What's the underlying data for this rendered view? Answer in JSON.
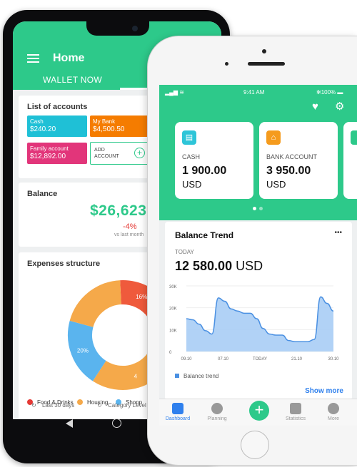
{
  "android": {
    "header": {
      "title": "Home",
      "tabs": [
        "WALLET NOW",
        "A"
      ]
    },
    "accounts": {
      "title": "List of accounts",
      "items": [
        {
          "name": "Cash",
          "amount": "$240.20",
          "color": "#1fc0d6"
        },
        {
          "name": "My Bank",
          "amount": "$4,500.50",
          "color": "#f57c00"
        },
        {
          "name": "Family account",
          "amount": "$12,892.00",
          "color": "#e2357a"
        }
      ],
      "add_label": [
        "ADD",
        "ACCOUNT"
      ]
    },
    "balance": {
      "title": "Balance",
      "amount": "$26,623.6",
      "change": "-4%",
      "vs": "vs last month"
    },
    "expenses": {
      "title": "Expenses structure",
      "chart_data": {
        "type": "pie",
        "title": "Expenses structure",
        "slices": [
          {
            "label": "16%",
            "value": 16,
            "color": "#ef5a3c"
          },
          {
            "label": "16%",
            "value": 16,
            "color": "#f06596"
          },
          {
            "label": "4",
            "value": 28,
            "color": "#f5a94a"
          },
          {
            "label": "20%",
            "value": 20,
            "color": "#5ab4ee"
          },
          {
            "label": "",
            "value": 20,
            "color": "#f5a94a"
          }
        ],
        "legend": [
          {
            "name": "Food & Drinks",
            "color": "#e53935"
          },
          {
            "name": "Housing",
            "color": "#f5a94a"
          },
          {
            "name": "Shopp",
            "color": "#5ab4ee"
          }
        ]
      }
    },
    "footer": {
      "period": "Last 30 days",
      "category": "Category Level 1"
    }
  },
  "iphone": {
    "status": {
      "time": "9:41 AM",
      "battery": "100%"
    },
    "cards": [
      {
        "label": "CASH",
        "value": "1 900.00",
        "currency": "USD",
        "icon_color": "#2ec5d8",
        "icon": "wallet-icon"
      },
      {
        "label": "BANK ACCOUNT",
        "value": "3 950.00",
        "currency": "USD",
        "icon_color": "#f59b1d",
        "icon": "bank-icon"
      }
    ],
    "trend": {
      "title": "Balance Trend",
      "menu": "•••",
      "period": "TODAY",
      "value": "12 580.00",
      "currency": "USD",
      "legend": "Balance trend",
      "show_more": "Show more",
      "chart_data": {
        "type": "area",
        "x_ticks": [
          "09.10",
          "07.10",
          "TODAY",
          "21.10",
          "30.10"
        ],
        "y_ticks": [
          "30K",
          "20K",
          "10K",
          "0"
        ],
        "ylim": [
          0,
          30000
        ],
        "x": [
          0,
          1,
          2,
          3,
          4,
          5,
          6,
          7,
          8,
          9,
          10,
          11,
          12,
          13,
          14,
          15,
          16,
          17,
          18,
          19,
          20,
          21,
          22,
          23
        ],
        "series": [
          {
            "name": "Balance trend",
            "values": [
              15000,
              14500,
              12500,
              9500,
              8000,
              24500,
              23000,
              19500,
              18500,
              17500,
              17500,
              15000,
              10500,
              8000,
              7500,
              7500,
              5000,
              4500,
              4500,
              4500,
              5500,
              25000,
              22000,
              18500
            ]
          }
        ],
        "color": "#4a90e2"
      }
    },
    "tabbar": [
      "Dashboard",
      "Planning",
      "",
      "Statistics",
      "More"
    ]
  }
}
